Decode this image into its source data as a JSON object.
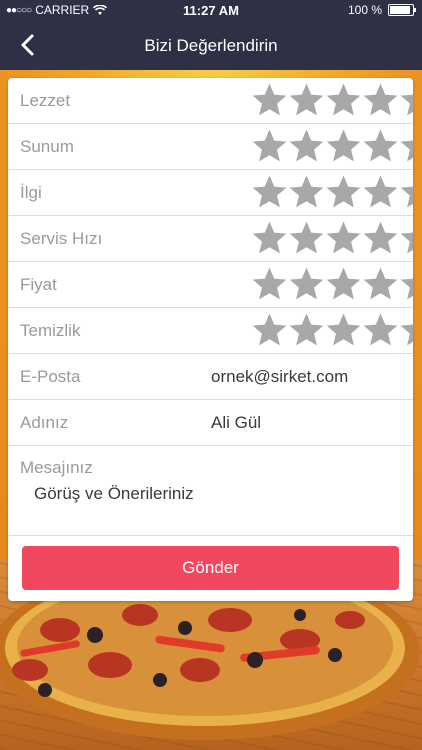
{
  "status_bar": {
    "signal": "●●○○○",
    "carrier": "CARRIER",
    "time": "11:27 AM",
    "battery": "100 %",
    "battery_level": 1.0
  },
  "nav": {
    "back_icon": "chevron-left-icon",
    "title": "Bizi Değerlendirin"
  },
  "ratings": [
    {
      "label": "Lezzet",
      "stars": 0,
      "max": 5
    },
    {
      "label": "Sunum",
      "stars": 0,
      "max": 5
    },
    {
      "label": "İlgi",
      "stars": 0,
      "max": 5
    },
    {
      "label": "Servis Hızı",
      "stars": 0,
      "max": 5
    },
    {
      "label": "Fiyat",
      "stars": 0,
      "max": 5
    },
    {
      "label": "Temizlik",
      "stars": 0,
      "max": 5
    }
  ],
  "fields": {
    "email": {
      "label": "E-Posta",
      "placeholder": "ornek@sirket.com"
    },
    "name": {
      "label": "Adınız",
      "placeholder": "Ali Gül"
    },
    "message": {
      "label": "Mesajınız",
      "placeholder": "Görüş ve Önerileriniz"
    }
  },
  "submit_label": "Gönder",
  "colors": {
    "header": "#2e3145",
    "submit": "#f2485e",
    "star_empty": "#a8a8a8",
    "label": "#9a9a9a"
  }
}
